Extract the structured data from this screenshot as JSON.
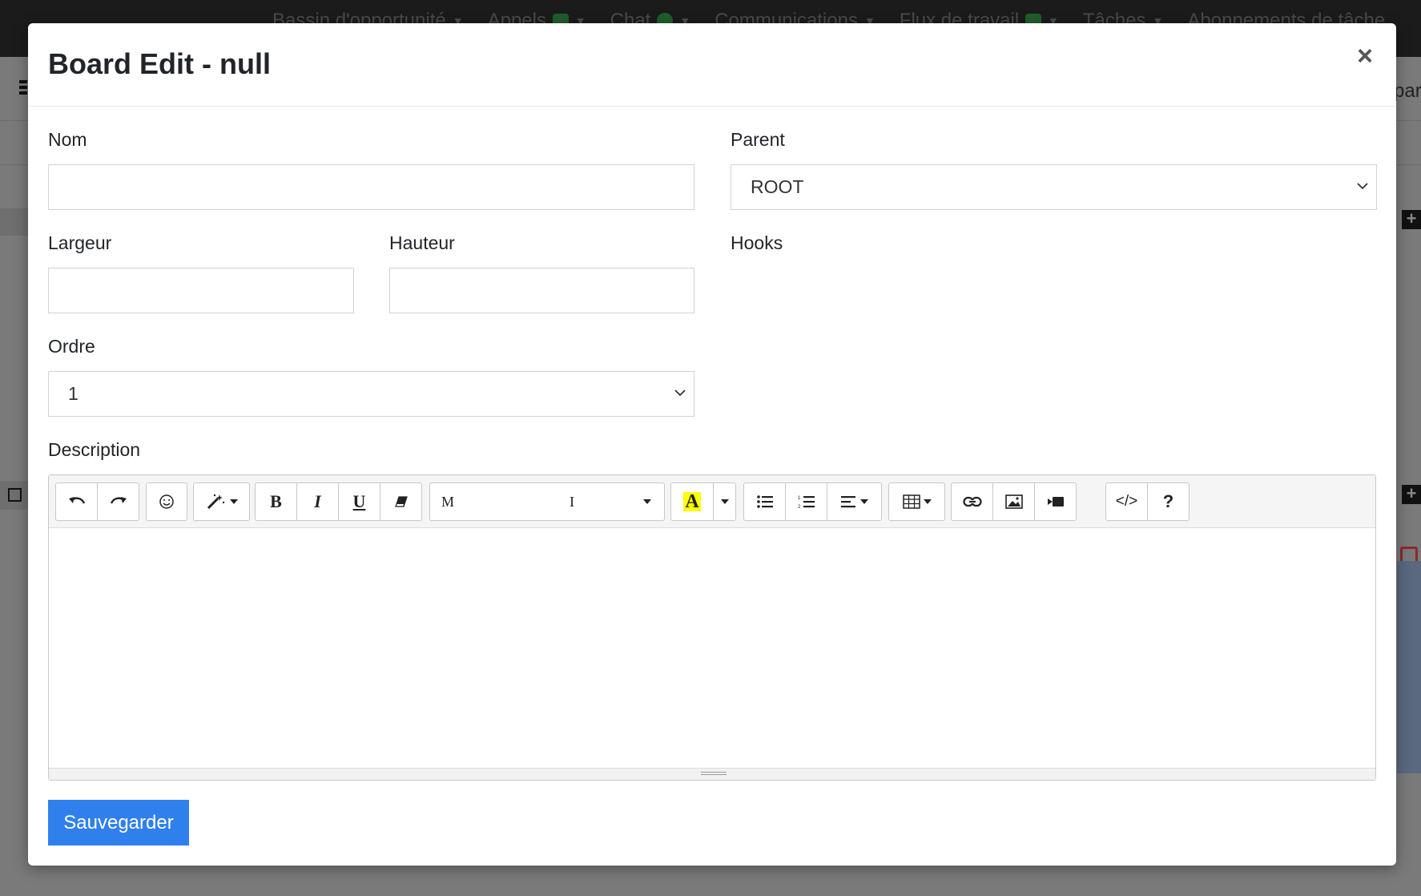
{
  "background": {
    "nav_items": [
      {
        "label": "Bassin d'opportunité"
      },
      {
        "label": "Appels",
        "badge": "1"
      },
      {
        "label": "Chat"
      },
      {
        "label": "Communications"
      },
      {
        "label": "Flux de travail",
        "badge": "1"
      },
      {
        "label": "Tâches"
      },
      {
        "label": "Abonnements de tâche"
      }
    ],
    "right_partial_text": "par"
  },
  "modal": {
    "title": "Board Edit - null",
    "close_label": "×",
    "fields": {
      "nom_label": "Nom",
      "nom_value": "",
      "parent_label": "Parent",
      "parent_value": "ROOT",
      "largeur_label": "Largeur",
      "largeur_value": "",
      "hauteur_label": "Hauteur",
      "hauteur_value": "",
      "hooks_label": "Hooks",
      "ordre_label": "Ordre",
      "ordre_value": "1",
      "description_label": "Description"
    },
    "editor": {
      "toolbar": {
        "bold": "B",
        "italic": "I",
        "underline": "U",
        "font_name_left": "M",
        "font_name_right": "I",
        "highlight": "A",
        "code_view": "</>",
        "help": "?"
      },
      "content": ""
    },
    "save_label": "Sauvegarder"
  },
  "colors": {
    "primary": "#2f80ed",
    "overlay": "#7a7a7a",
    "badge_green": "#1f5e2a"
  }
}
